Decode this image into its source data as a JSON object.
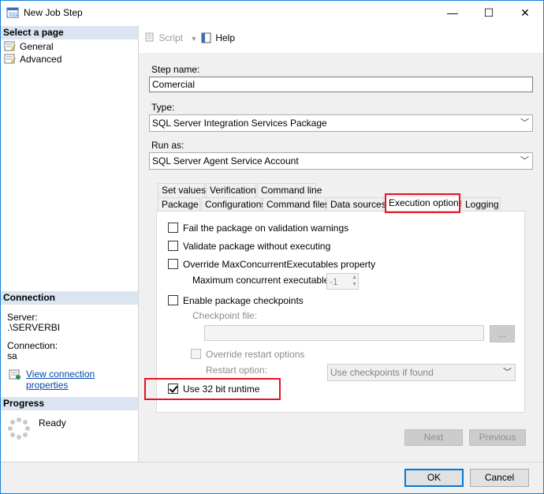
{
  "window": {
    "title": "New Job Step"
  },
  "caption_buttons": {
    "minimize": "—",
    "maximize": "☐",
    "close": "✕"
  },
  "left_pane": {
    "select_page_header": "Select a page",
    "pages": [
      {
        "label": "General"
      },
      {
        "label": "Advanced"
      }
    ],
    "connection_header": "Connection",
    "server_label": "Server:",
    "server_value": ".\\SERVERBI",
    "connection_label": "Connection:",
    "connection_value": "sa",
    "view_connection_link": "View connection properties",
    "progress_header": "Progress",
    "progress_status": "Ready"
  },
  "toolbar": {
    "script_label": "Script",
    "help_label": "Help"
  },
  "form": {
    "step_name_label": "Step name:",
    "step_name_value": "Comercial",
    "type_label": "Type:",
    "type_value": "SQL Server Integration Services Package",
    "run_as_label": "Run as:",
    "run_as_value": "SQL Server Agent Service Account"
  },
  "tabs": {
    "row1": [
      {
        "label": "Set values"
      },
      {
        "label": "Verification"
      },
      {
        "label": "Command line"
      }
    ],
    "row2": [
      {
        "label": "Package"
      },
      {
        "label": "Configurations"
      },
      {
        "label": "Command files"
      },
      {
        "label": "Data sources"
      },
      {
        "label": "Execution options"
      },
      {
        "label": "Logging"
      }
    ],
    "selected": "Execution options"
  },
  "execution_options": {
    "fail_on_warnings": {
      "label": "Fail the package on validation warnings",
      "checked": false
    },
    "validate_without_executing": {
      "label": "Validate package without executing",
      "checked": false
    },
    "override_max_concurrent": {
      "label": "Override MaxConcurrentExecutables property",
      "checked": false
    },
    "max_concurrent_label": "Maximum concurrent executables:",
    "max_concurrent_value": "-1",
    "enable_checkpoints": {
      "label": "Enable package checkpoints",
      "checked": false
    },
    "checkpoint_file_label": "Checkpoint file:",
    "checkpoint_file_value": "",
    "browse_button": "...",
    "override_restart": {
      "label": "Override restart options",
      "checked": false
    },
    "restart_option_label": "Restart option:",
    "restart_option_value": "Use checkpoints if found",
    "use_32bit": {
      "label": "Use 32 bit runtime",
      "checked": true
    }
  },
  "nav_buttons": {
    "next": "Next",
    "previous": "Previous"
  },
  "footer": {
    "ok": "OK",
    "cancel": "Cancel"
  },
  "colors": {
    "highlight": "#e81123",
    "section_header": "#dbe4f1",
    "panel_bg": "#f0f0f0",
    "link": "#0645ad"
  }
}
